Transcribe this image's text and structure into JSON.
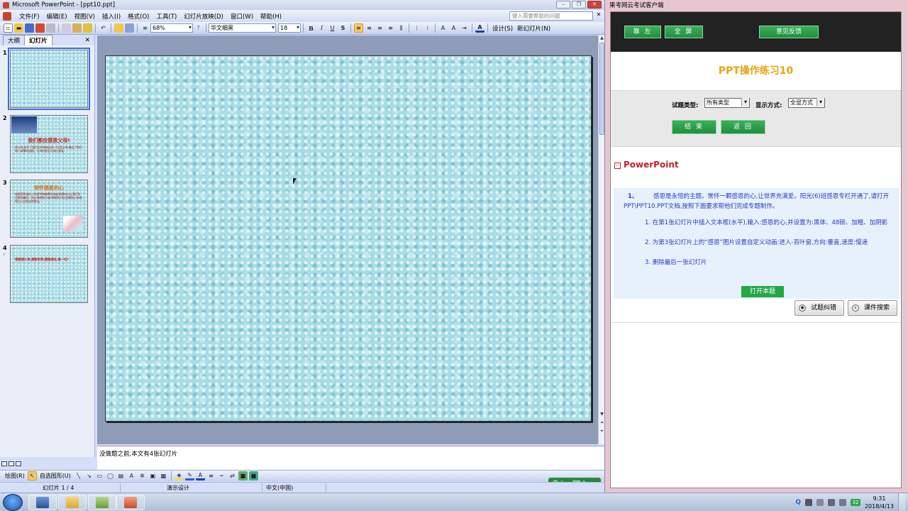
{
  "ppt": {
    "title": "Microsoft PowerPoint - [ppt10.ppt]",
    "menu": [
      "文件(F)",
      "编辑(E)",
      "视图(V)",
      "插入(I)",
      "格式(O)",
      "工具(T)",
      "幻灯片放映(D)",
      "窗口(W)",
      "帮助(H)"
    ],
    "help_placeholder": "键入需要帮助的问题",
    "zoom": "68%",
    "font_name": "华文细黑",
    "font_size": "18",
    "design_label": "设计(S)",
    "new_slide_label": "新幻灯片(N)",
    "tabs": [
      "大纲",
      "幻灯片"
    ],
    "thumbnails": [
      {
        "num": "1",
        "title": "",
        "body": ""
      },
      {
        "num": "2",
        "title": "我们都应感恩父母!",
        "body": "是父母,给予了我们生命和成长的一切;是父母,教会了我们做人做事的道理。父母的爱比天高比海深。"
      },
      {
        "num": "3",
        "title": "常怀感恩的心",
        "body": "感恩是积极向上的思考和谦卑的态度,感恩的心让我们生活更加美好。对父母感恩,对老师感恩,对社会感恩,心存感恩之心方能走得更远。"
      },
      {
        "num": "4",
        "title": "",
        "body": "我感谢父母,感谢老师,感谢朋友,谢一切!"
      }
    ],
    "notes": "没做题之前,本文有4张幻灯片",
    "draw_label": "绘图(R)",
    "autoshape_label": "自选图形(U)",
    "status": {
      "slide": "幻灯片 1 / 4",
      "design": "演示设计",
      "lang": "中文(中国)"
    },
    "ime": "中 ☾ ·, ⌨ ✎"
  },
  "exam": {
    "window_title": "果考网云考试客户端",
    "top_buttons": [
      "靠 左",
      "全 屏",
      "意见反馈"
    ],
    "heading": "PPT操作练习10",
    "filter_type_label": "试题类型:",
    "filter_type_value": "所有类型",
    "filter_display_label": "显示方式:",
    "filter_display_value": "全显方式",
    "end_button": "结 束",
    "back_button": "返 回",
    "section": "PowerPoint",
    "question": {
      "number": "1、",
      "intro": "感恩是永恒的主题。常怀一颗感恩的心,让世界充满爱。阳光(6)班感恩专栏开通了,请打开PPT\\PPT10.PPT文档,按照下面要求帮他们完成专题制作。",
      "steps": [
        "1. 在第1张幻灯片中插入文本框(水平),输入:感恩的心,并设置为:黑体、48磅、加粗、加阴影",
        "2. 为第3张幻灯片上的“感恩”图片设置自定义动画:进入-百叶窗,方向:垂直,速度:慢速",
        "3. 删除最后一张幻灯片"
      ],
      "open_button": "打开本题"
    },
    "correct_button": "试题纠错",
    "search_button": "课件搜索"
  },
  "taskbar": {
    "time": "9:31",
    "date": "2018/4/13",
    "tray_num": "32"
  },
  "colors": {
    "slide_bg": "#a6dde6",
    "green_button": "#22a845",
    "exam_heading": "#e8a310",
    "section_red": "#c0202a",
    "question_blue": "#2b3ac4"
  }
}
